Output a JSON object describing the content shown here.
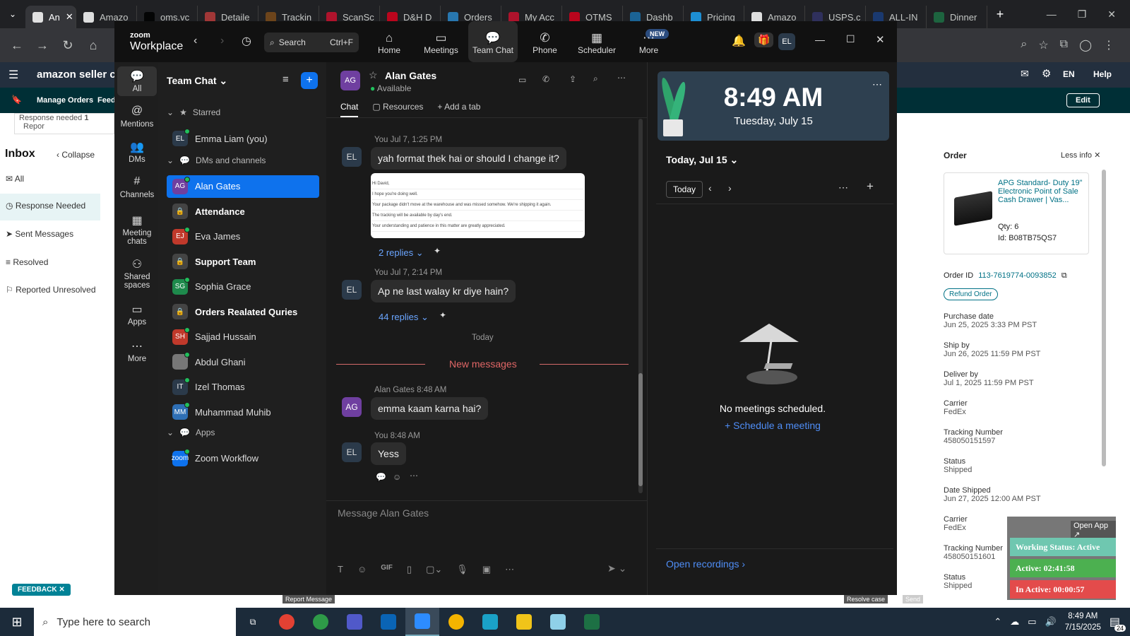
{
  "browser": {
    "tabs": [
      {
        "label": "An",
        "color": "#ffffff"
      },
      {
        "label": "Amazo",
        "color": "#ffffff"
      },
      {
        "label": "oms.vc",
        "color": "#000000"
      },
      {
        "label": "Detaile",
        "color": "#b73b3b"
      },
      {
        "label": "Trackin",
        "color": "#7a4a1a"
      },
      {
        "label": "ScanSc",
        "color": "#c8102e"
      },
      {
        "label": "D&H D",
        "color": "#d6001c"
      },
      {
        "label": "Orders",
        "color": "#2a86c8"
      },
      {
        "label": "My Acc",
        "color": "#c8102e"
      },
      {
        "label": "OTMS",
        "color": "#d6001c"
      },
      {
        "label": "Dashb",
        "color": "#1b6fa8"
      },
      {
        "label": "Pricing",
        "color": "#1da1f2"
      },
      {
        "label": "Amazo",
        "color": "#ffffff"
      },
      {
        "label": "USPS.c",
        "color": "#333366"
      },
      {
        "label": "ALL-IN",
        "color": "#1a3d7c"
      },
      {
        "label": "Dinner",
        "color": "#1d7044"
      }
    ]
  },
  "amazon": {
    "logo": "amazon seller cent",
    "manage_orders": "Manage Orders",
    "feed": "Feedb",
    "lang": "EN",
    "help": "Help",
    "edit": "Edit",
    "response_needed": "Response needed",
    "response_count": "1",
    "report": "Repor",
    "inbox_title": "Inbox",
    "collapse": "Collapse",
    "inbox_items": [
      "All",
      "Response Needed",
      "Sent Messages",
      "Resolved",
      "Reported Unresolved"
    ],
    "feedback": "FEEDBACK",
    "order_panel": {
      "title": "Order",
      "less_info": "Less info",
      "product_title": "APG Standard- Duty 19\" Electronic Point of Sale Cash Drawer | Vas...",
      "qty": "Qty: 6",
      "id": "Id: B08TB75QS7",
      "order_id_label": "Order ID",
      "order_id": "113-7619774-0093852",
      "refund": "Refund Order",
      "fields": [
        {
          "label": "Purchase date",
          "value": "Jun 25, 2025 3:33 PM PST"
        },
        {
          "label": "Ship by",
          "value": "Jun 26, 2025 11:59 PM PST"
        },
        {
          "label": "Deliver by",
          "value": "Jul 1, 2025 11:59 PM PST"
        },
        {
          "label": "Carrier",
          "value": "FedEx"
        },
        {
          "label": "Tracking Number",
          "value": "458050151597"
        },
        {
          "label": "Status",
          "value": "Shipped"
        },
        {
          "label": "Date Shipped",
          "value": "Jun 27, 2025 12:00 AM PST"
        },
        {
          "label": "Carrier",
          "value": "FedEx"
        },
        {
          "label": "Tracking Number",
          "value": "458050151601"
        },
        {
          "label": "Status",
          "value": "Shipped"
        }
      ],
      "report_message": "Report Message",
      "resolve_case": "Resolve case",
      "send": "Send"
    }
  },
  "zoom": {
    "brand_top": "zoom",
    "brand_bottom": "Workplace",
    "search_placeholder": "Search",
    "search_shortcut": "Ctrl+F",
    "nav": [
      {
        "label": "Home",
        "icon": "home-icon"
      },
      {
        "label": "Meetings",
        "icon": "video-icon"
      },
      {
        "label": "Team Chat",
        "icon": "chat-icon"
      },
      {
        "label": "Phone",
        "icon": "phone-icon"
      },
      {
        "label": "Scheduler",
        "icon": "calendar-icon"
      },
      {
        "label": "More",
        "icon": "more-icon"
      }
    ],
    "new_badge": "NEW",
    "user_initials": "EL",
    "rail": [
      {
        "label": "All"
      },
      {
        "label": "Mentions"
      },
      {
        "label": "DMs"
      },
      {
        "label": "Channels"
      },
      {
        "label": "Meeting chats"
      },
      {
        "label": "Shared spaces"
      },
      {
        "label": "Apps"
      },
      {
        "label": "More"
      }
    ],
    "list_title": "Team Chat",
    "starred": "Starred",
    "starred_items": [
      {
        "initials": "EL",
        "name": "Emma Liam (you)",
        "color": "#2b3a4a"
      }
    ],
    "dms_label": "DMs and channels",
    "dms": [
      {
        "initials": "AG",
        "name": "Alan Gates",
        "color": "#6f3fa0",
        "selected": true,
        "bold": false,
        "lock": false
      },
      {
        "initials": "",
        "name": "Attendance",
        "color": "#444",
        "selected": false,
        "bold": true,
        "lock": true
      },
      {
        "initials": "EJ",
        "name": "Eva James",
        "color": "#c0392b",
        "selected": false,
        "bold": false,
        "lock": false
      },
      {
        "initials": "",
        "name": "Support Team",
        "color": "#444",
        "selected": false,
        "bold": true,
        "lock": true
      },
      {
        "initials": "SG",
        "name": "Sophia Grace",
        "color": "#1e8a4c",
        "selected": false,
        "bold": false,
        "lock": false
      },
      {
        "initials": "",
        "name": "Orders Realated Quries",
        "color": "#444",
        "selected": false,
        "bold": true,
        "lock": true
      },
      {
        "initials": "SH",
        "name": "Sajjad Hussain",
        "color": "#c0392b",
        "selected": false,
        "bold": false,
        "lock": false
      },
      {
        "initials": "",
        "name": "Abdul Ghani",
        "color": "#777",
        "selected": false,
        "bold": false,
        "lock": false
      },
      {
        "initials": "IT",
        "name": "Izel Thomas",
        "color": "#2b3a4a",
        "selected": false,
        "bold": false,
        "lock": false
      },
      {
        "initials": "MM",
        "name": "Muhammad Muhib",
        "color": "#2e6fb5",
        "selected": false,
        "bold": false,
        "lock": false
      }
    ],
    "apps_label": "Apps",
    "apps": [
      {
        "initials": "zoom",
        "name": "Zoom Workflow",
        "color": "#0e72ed"
      }
    ],
    "chat": {
      "contact": "Alan Gates",
      "contact_initials": "AG",
      "status": "Available",
      "tabs": [
        "Chat",
        "Resources",
        "Add a tab"
      ],
      "m1_meta": "You Jul 7, 1:25 PM",
      "m1_text": "yah format thek hai or should I change it?",
      "email_lines": [
        "Hi David,",
        "I hope you're doing well.",
        "Your package didn't move at the warehouse and was missed somehow. We're shipping it again.",
        "The tracking will be available by day's end.",
        "Your understanding and patience in this matter are greatly appreciated."
      ],
      "m1_replies": "2 replies",
      "m2_meta": "You Jul 7, 2:14 PM",
      "m2_text": "Ap ne last walay kr diye hain?",
      "m2_replies": "44 replies",
      "today": "Today",
      "new_messages": "New messages",
      "m3_name": "Alan Gates",
      "m3_time": "8:48 AM",
      "m3_text": "emma kaam karna hai?",
      "m4_meta": "You 8:48 AM",
      "m4_text": "Yess",
      "compose_placeholder": "Message Alan Gates",
      "me_initials": "EL"
    },
    "calendar": {
      "time": "8:49 AM",
      "date": "Tuesday, July 15",
      "day_select": "Today, Jul 15",
      "today_btn": "Today",
      "empty": "No meetings scheduled.",
      "schedule": "Schedule a meeting",
      "recordings": "Open recordings"
    }
  },
  "status_widget": {
    "open_app": "Open App",
    "working": "Working Status: Active",
    "active": "Active: 02:41:58",
    "inactive": "In Active: 00:00:57"
  },
  "taskbar": {
    "search_placeholder": "Type here to search",
    "time": "8:49 AM",
    "date": "7/15/2025",
    "notif_count": "24"
  }
}
